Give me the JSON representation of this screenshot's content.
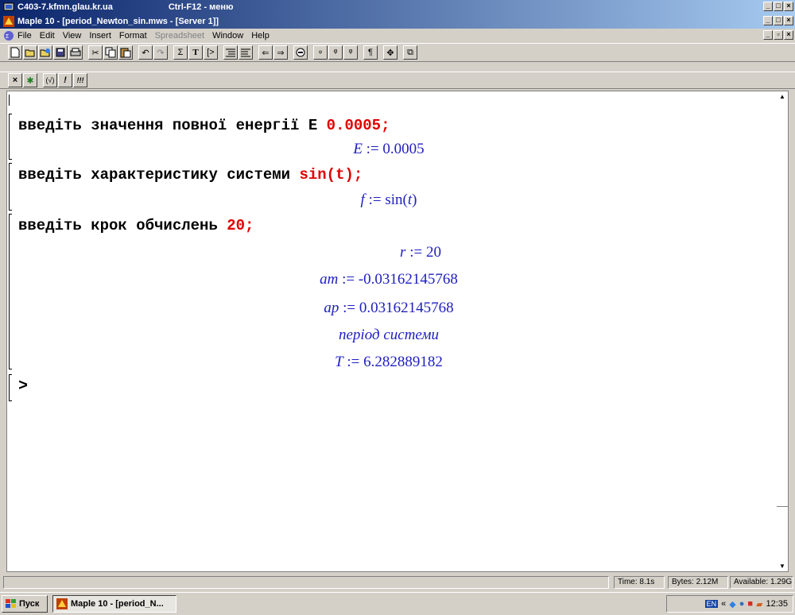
{
  "outer_window": {
    "title": "C403-7.kfmn.glau.kr.ua",
    "hotkey": "Ctrl-F12 - меню"
  },
  "app_window": {
    "title": "Maple 10 - [period_Newton_sin.mws - [Server 1]]"
  },
  "menu": {
    "items": [
      {
        "label": "File",
        "enabled": true
      },
      {
        "label": "Edit",
        "enabled": true
      },
      {
        "label": "View",
        "enabled": true
      },
      {
        "label": "Insert",
        "enabled": true
      },
      {
        "label": "Format",
        "enabled": true
      },
      {
        "label": "Spreadsheet",
        "enabled": false
      },
      {
        "label": "Window",
        "enabled": true
      },
      {
        "label": "Help",
        "enabled": true
      }
    ]
  },
  "toolbar2": {
    "bang": "!",
    "triple_bang": "!!!",
    "paren": "(√)"
  },
  "toolbar1_glyphs": {
    "sigma": "Σ",
    "text": "T",
    "pilcrow": "¶"
  },
  "worksheet": {
    "cmd1": {
      "text": "введіть значення повної енергії E ",
      "value": "0.0005;"
    },
    "out1": {
      "lhs": "E",
      "rhs": " := 0.0005"
    },
    "cmd2": {
      "text": "введіть характеристику системи ",
      "value": "sin(t);"
    },
    "out2": {
      "lhs": "f",
      "mid": " := sin(",
      "var": "t",
      "end": ")"
    },
    "cmd3": {
      "text": "введіть крок обчислень ",
      "value": "20;"
    },
    "out3": {
      "lhs": "r",
      "rhs": " := 20"
    },
    "out4": {
      "lhs": "am",
      "rhs": " := -0.03162145768"
    },
    "out5": {
      "lhs": "ap",
      "rhs": " := 0.03162145768"
    },
    "out6": {
      "text": "період системи"
    },
    "out7": {
      "lhs": "T",
      "rhs": " := 6.282889182"
    },
    "prompt": ">"
  },
  "status": {
    "time": "Time: 8.1s",
    "bytes": "Bytes: 2.12M",
    "available": "Available: 1.29G"
  },
  "taskbar": {
    "start": "Пуск",
    "task": "Maple 10 - [period_N...",
    "lang": "EN",
    "clock": "12:35"
  },
  "colors": {
    "input_text": "#000000",
    "input_value": "#e00000",
    "output": "#2020c0"
  }
}
